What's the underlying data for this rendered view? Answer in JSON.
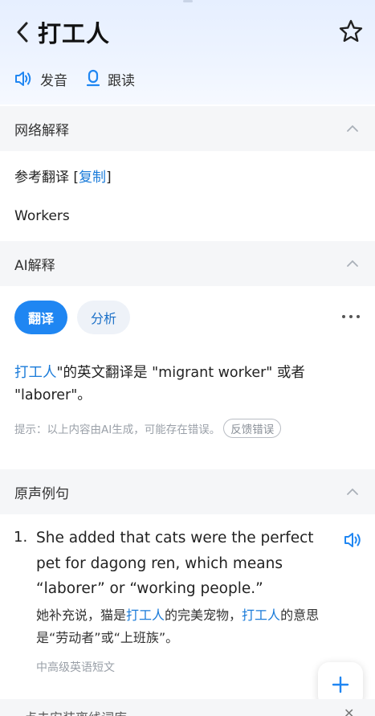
{
  "header": {
    "title": "打工人",
    "pronounce_label": "发音",
    "follow_read_label": "跟读"
  },
  "web_section": {
    "heading": "网络解释",
    "ref_prefix": "参考翻译 [",
    "copy_link": "复制",
    "ref_suffix": "]",
    "translation": "Workers"
  },
  "ai_section": {
    "heading": "AI解释",
    "tab_translate": "翻译",
    "tab_analyze": "分析",
    "answer_highlight": "打工人",
    "answer_rest": "\"的英文翻译是 \"migrant worker\" 或者 \"laborer\"。",
    "hint": "提示：以上内容由AI生成，可能存在错误。",
    "feedback": "反馈错误"
  },
  "examples_section": {
    "heading": "原声例句",
    "items": [
      {
        "number": "1.",
        "english": "She added that cats were the perfect pet for dagong ren, which means “laborer” or “working people.”",
        "cn_part1": "她补充说，猫是",
        "cn_hl1": "打工人",
        "cn_part2": "的完美宠物，",
        "cn_hl2": "打工人",
        "cn_part3": "的意思是“劳动者”或“上班族”。",
        "source": "中高级英语短文"
      }
    ]
  },
  "bottom_banner": {
    "text": "点击安装离线词库"
  },
  "colors": {
    "accent": "#1f86f2",
    "link": "#1a7bd9",
    "section_bg": "#f5f6f8"
  }
}
